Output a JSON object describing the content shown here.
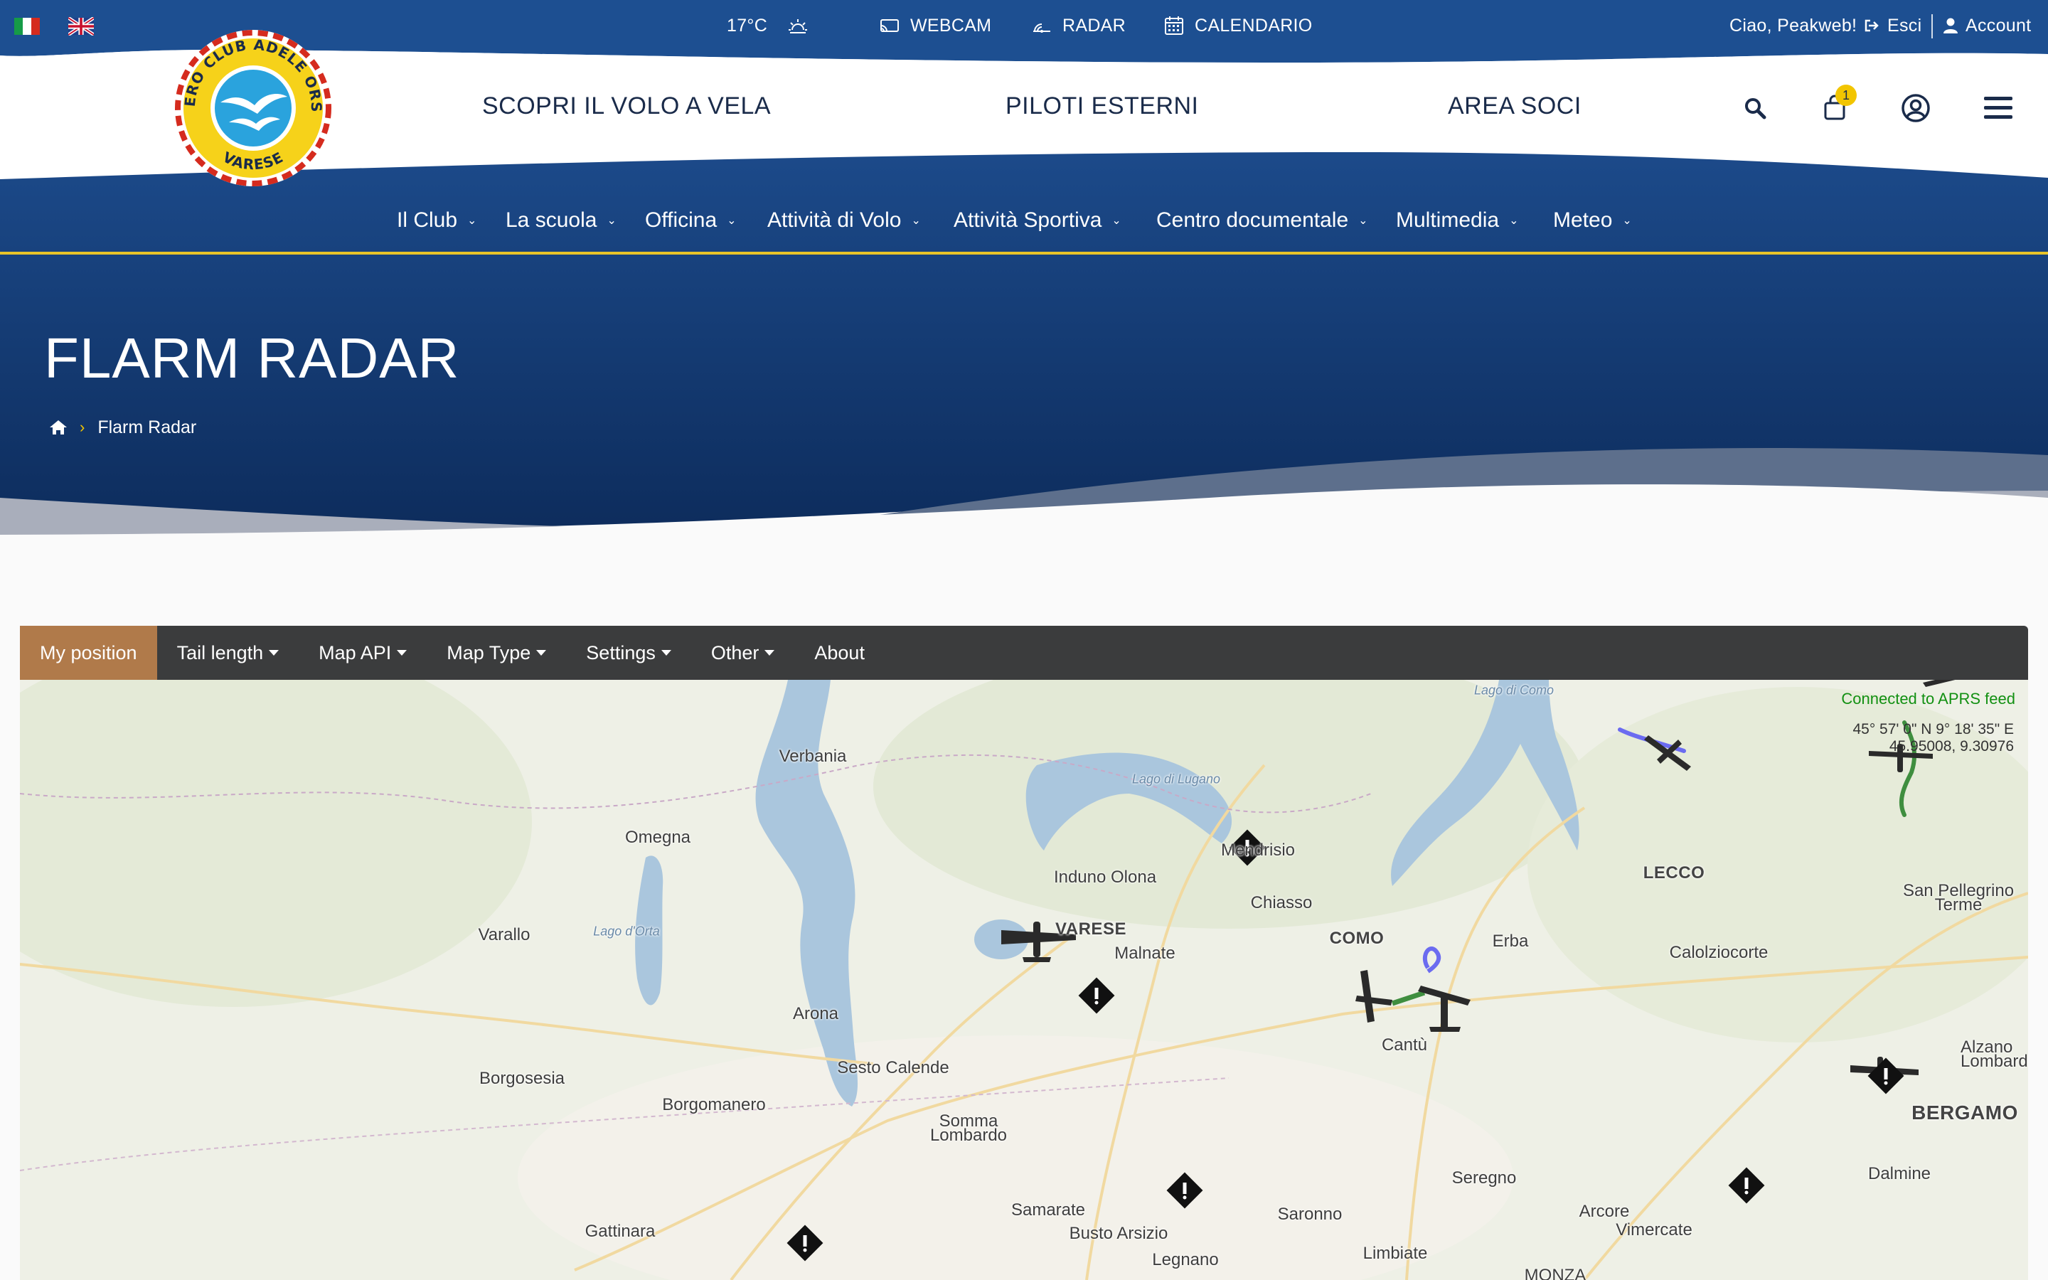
{
  "topbar": {
    "temperature": "17°C",
    "links": {
      "webcam": "WEBCAM",
      "radar": "RADAR",
      "calendar": "CALENDARIO"
    },
    "greeting": "Ciao, Peakweb!",
    "logout": "Esci",
    "account": "Account"
  },
  "logo": {
    "text_top": "AERO CLUB ADELE ORSI",
    "text_bottom": "VARESE"
  },
  "header": {
    "nav": [
      "SCOPRI IL VOLO A VELA",
      "PILOTI ESTERNI",
      "AREA SOCI"
    ],
    "cart_count": "1"
  },
  "subnav": [
    "Il Club",
    "La scuola",
    "Officina",
    "Attività di Volo",
    "Attività Sportiva",
    "Centro documentale",
    "Multimedia",
    "Meteo"
  ],
  "hero": {
    "title": "FLARM RADAR",
    "breadcrumb_current": "Flarm Radar"
  },
  "toolbar": {
    "items": [
      "My position",
      "Tail length",
      "Map API",
      "Map Type",
      "Settings",
      "Other",
      "About"
    ],
    "active": "My position"
  },
  "map": {
    "status": "Connected to APRS feed",
    "coord_dms": "45° 57' 0\" N 9° 18' 35\" E",
    "coord_dec": "45.95008, 9.30976",
    "places": [
      {
        "name": "Verbania"
      },
      {
        "name": "Omegna"
      },
      {
        "name": "Varallo"
      },
      {
        "name": "Arona"
      },
      {
        "name": "Borgosesia"
      },
      {
        "name": "Borgomanero"
      },
      {
        "name": "Sesto Calende"
      },
      {
        "name": "Somma Lombardo"
      },
      {
        "name": "Gattinara"
      },
      {
        "name": "Samarate"
      },
      {
        "name": "Busto Arsizio"
      },
      {
        "name": "Legnano"
      },
      {
        "name": "Saronno"
      },
      {
        "name": "Limbiate"
      },
      {
        "name": "Seregno"
      },
      {
        "name": "Arcore"
      },
      {
        "name": "Vimercate"
      },
      {
        "name": "Induno Olona"
      },
      {
        "name": "VARESE"
      },
      {
        "name": "Malnate"
      },
      {
        "name": "Mendrisio"
      },
      {
        "name": "Chiasso"
      },
      {
        "name": "COMO"
      },
      {
        "name": "Erba"
      },
      {
        "name": "Cantù"
      },
      {
        "name": "LECCO"
      },
      {
        "name": "Calolziocorte"
      },
      {
        "name": "San Pellegrino Terme"
      },
      {
        "name": "BERGAMO"
      },
      {
        "name": "Dalmine"
      },
      {
        "name": "MONZA"
      },
      {
        "name": "Alzano Lombardo"
      },
      {
        "name": "Lago d'Orta"
      },
      {
        "name": "Lago di Lugano"
      },
      {
        "name": "Lago di Como"
      }
    ]
  }
}
